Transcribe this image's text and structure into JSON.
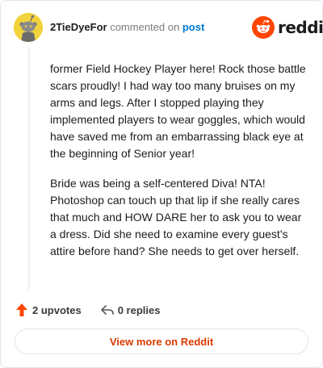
{
  "comment": {
    "username": "2TieDyeFor",
    "action_text": "commented on",
    "post_link": "post",
    "paragraphs": [
      "former Field Hockey Player here! Rock those battle scars proudly! I had way too many bruises on my arms and legs. After I stopped playing they implemented players to wear goggles, which would have saved me from an embarrassing black eye at the beginning of Senior year!",
      "Bride was being a self-centered Diva! NTA! Photoshop can touch up that lip if she really cares that much and HOW DARE her to ask you to wear a dress. Did she need to examine every guest's attire before hand? She needs to get over herself."
    ]
  },
  "brand": {
    "wordmark": "reddit",
    "color": "#ff4500"
  },
  "actions": {
    "upvotes_label": "2 upvotes",
    "replies_label": "0 replies",
    "upvote_icon": "upvote-arrow-icon",
    "reply_icon": "reply-arrow-icon",
    "upvote_color": "#ff4500"
  },
  "footer": {
    "view_button_label": "View more on Reddit",
    "accent": "#d93a00"
  },
  "avatar": {
    "icon": "snoo-avatar-icon",
    "background": "#f2d33c"
  }
}
